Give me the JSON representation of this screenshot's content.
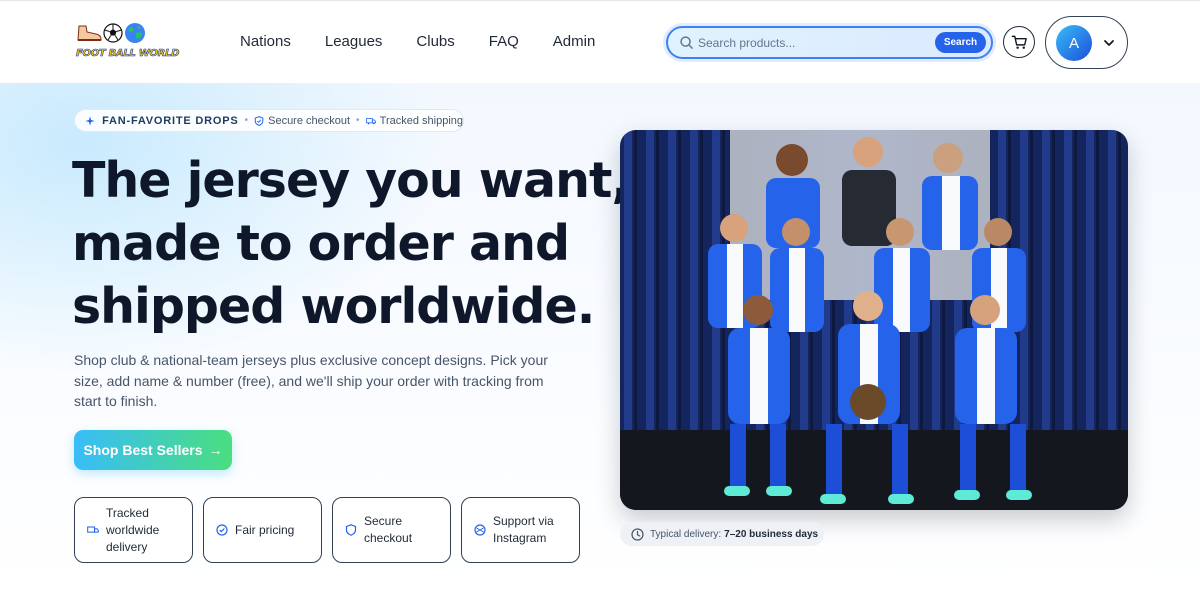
{
  "brand": {
    "logo_text": "FOOT BALL WORLD"
  },
  "nav": {
    "items": [
      "Nations",
      "Leagues",
      "Clubs",
      "FAQ",
      "Admin"
    ]
  },
  "search": {
    "placeholder": "Search products...",
    "button_label": "Search"
  },
  "user": {
    "avatar_initial": "A"
  },
  "hero": {
    "badge_main": "FAN-FAVORITE DROPS",
    "badge_secure": "Secure checkout",
    "badge_shipping": "Tracked shipping",
    "headline": [
      "The jersey you want,",
      "made to order and",
      "shipped worldwide."
    ],
    "description": "Shop club & national-team jerseys plus exclusive concept designs. Pick your size, add name & number (free), and we'll ship your order with tracking from start to finish.",
    "cta_label": "Shop Best Sellers",
    "cta_arrow": "→",
    "features": [
      {
        "label": "Tracked worldwide delivery",
        "icon": "truck-icon"
      },
      {
        "label": "Fair pricing",
        "icon": "badge-check-icon"
      },
      {
        "label": "Secure checkout",
        "icon": "shield-icon"
      },
      {
        "label": "Support via Instagram",
        "icon": "instagram-icon"
      }
    ],
    "delivery_label": "Typical delivery:",
    "delivery_value": "7–20 business days"
  },
  "colors": {
    "accent": "#2563eb",
    "cta_start": "#38bdf8",
    "cta_end": "#4ade80",
    "jersey": "#1d4ed8"
  }
}
